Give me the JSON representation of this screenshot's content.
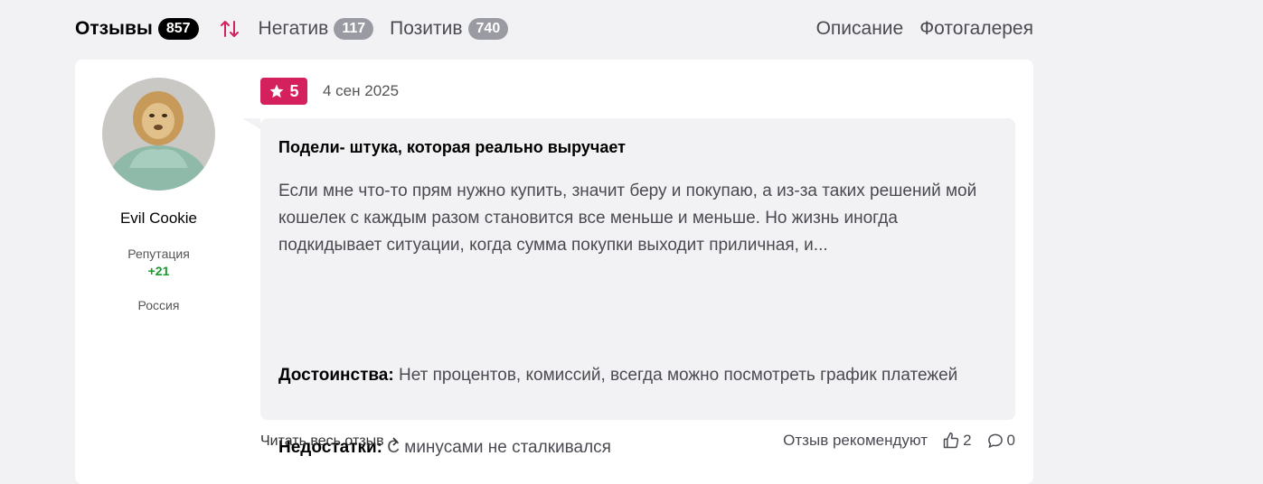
{
  "tabs": {
    "reviews": {
      "label": "Отзывы",
      "count": "857"
    },
    "negative": {
      "label": "Негатив",
      "count": "117"
    },
    "positive": {
      "label": "Позитив",
      "count": "740"
    },
    "description": "Описание",
    "gallery": "Фотогалерея"
  },
  "review": {
    "author": {
      "name": "Evil Cookie",
      "reputation_label": "Репутация",
      "reputation_value": "+21",
      "country": "Россия"
    },
    "rating": "5",
    "date": "4 сен 2025",
    "title": "Подели- штука, которая реально выручает",
    "text": "Если мне что-то прям нужно купить, значит беру и покупаю, а из-за таких решений мой кошелек с каждым разом становится все меньше и меньше. Но жизнь иногда подкидывает ситуации, когда сумма покупки выходит приличная, и...",
    "pros_label": "Достоинства:",
    "pros": "Нет процентов, комиссий, всегда можно посмотреть график платежей",
    "cons_label": "Недостатки:",
    "cons": "С минусами не сталкивался",
    "read_more": "Читать весь отзыв",
    "recommend_text": "Отзыв рекомендуют",
    "likes": "2",
    "comments": "0"
  },
  "colors": {
    "accent": "#d4205c",
    "reputation": "#1a9a2a",
    "badge_gray": "#9a9aa3"
  }
}
